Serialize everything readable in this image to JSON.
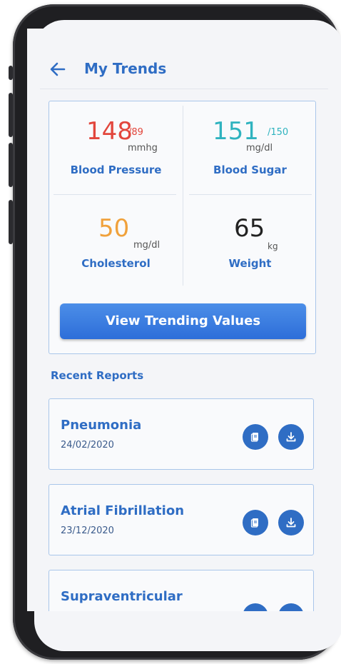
{
  "header": {
    "title": "My Trends",
    "back_icon": "arrow-left-icon"
  },
  "metrics": {
    "blood_pressure": {
      "value": "148",
      "secondary": "/89",
      "unit": "mmhg",
      "label": "Blood Pressure",
      "color": "#e2463c"
    },
    "blood_sugar": {
      "value": "151",
      "secondary": "/150",
      "unit": "mg/dl",
      "label": "Blood Sugar",
      "color": "#2fb3bf"
    },
    "cholesterol": {
      "value": "50",
      "unit": "mg/dl",
      "label": "Cholesterol",
      "color": "#f0a13b"
    },
    "weight": {
      "value": "65",
      "unit": "kg",
      "label": "Weight",
      "color": "#222222"
    }
  },
  "cta": {
    "label": "View Trending Values"
  },
  "reports": {
    "section_title": "Recent Reports",
    "items": [
      {
        "name": "Pneumonia",
        "date": "24/02/2020"
      },
      {
        "name": "Atrial Fibrillation",
        "date": "23/12/2020"
      },
      {
        "name": "Supraventricular",
        "date": ""
      }
    ],
    "icons": {
      "view": "document-icon",
      "download": "download-icon"
    }
  },
  "colors": {
    "accent": "#2f6dc4",
    "button_gradient_top": "#4c8ee8",
    "button_gradient_bottom": "#2d6ed9",
    "card_border": "#a9c6ea"
  }
}
